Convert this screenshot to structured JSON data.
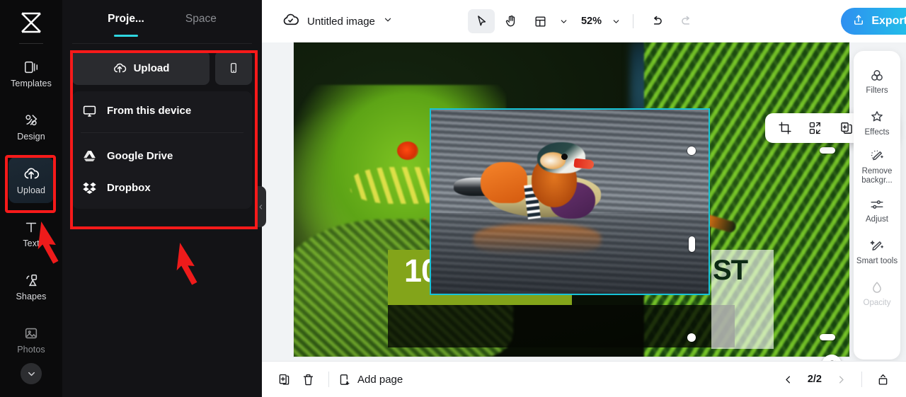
{
  "app": {
    "brand_icon": "capcut-logo-icon",
    "accent": "#2fd6e0",
    "highlight_color": "#f61a1a"
  },
  "left_rail": {
    "items": [
      {
        "label": "Templates",
        "icon": "templates-icon",
        "active": false
      },
      {
        "label": "Design",
        "icon": "design-icon",
        "active": false
      },
      {
        "label": "Upload",
        "icon": "upload-cloud-icon",
        "active": true
      },
      {
        "label": "Text",
        "icon": "text-icon",
        "active": false
      },
      {
        "label": "Shapes",
        "icon": "shapes-icon",
        "active": false
      },
      {
        "label": "Photos",
        "icon": "photos-icon",
        "active": false
      }
    ],
    "more_icon": "chevron-down-icon"
  },
  "panel": {
    "tabs": [
      {
        "label": "Proje...",
        "active": true
      },
      {
        "label": "Space",
        "active": false
      }
    ],
    "upload_button": {
      "label": "Upload",
      "icon": "upload-cloud-icon"
    },
    "phone_button": {
      "icon": "mobile-phone-icon"
    },
    "sources": [
      {
        "label": "From this device",
        "icon": "monitor-icon"
      },
      {
        "label": "Google Drive",
        "icon": "google-drive-icon"
      },
      {
        "label": "Dropbox",
        "icon": "dropbox-icon"
      }
    ],
    "collapse_icon": "chevron-left-icon"
  },
  "topbar": {
    "doc_icon": "cloud-saved-icon",
    "doc_title": "Untitled image",
    "doc_chevron": "chevron-down-icon",
    "tools": [
      {
        "name": "select-tool",
        "icon": "cursor-arrow-icon",
        "selected": true
      },
      {
        "name": "hand-tool",
        "icon": "hand-icon",
        "selected": false
      },
      {
        "name": "layout-tool",
        "icon": "layout-panel-icon",
        "selected": false
      }
    ],
    "zoom_value": "52%",
    "zoom_chevron": "chevron-down-icon",
    "undo_icon": "undo-arrow-icon",
    "redo_icon": "redo-arrow-icon",
    "export_button": {
      "label": "Export",
      "icon": "export-upload-icon"
    }
  },
  "object_toolbar": {
    "buttons": [
      {
        "name": "crop-button",
        "icon": "crop-icon"
      },
      {
        "name": "replace-button",
        "icon": "replace-swap-icon"
      },
      {
        "name": "duplicate-button",
        "icon": "duplicate-icon"
      },
      {
        "name": "more-button",
        "icon": "ellipsis-icon"
      }
    ]
  },
  "canvas": {
    "green_banner_text": "10",
    "ghost_overlay_text": "ST",
    "green_color": "#83a41a",
    "selection_color": "#17c3d6",
    "rotate_icon": "rotate-icon"
  },
  "right_tools": [
    {
      "label": "Filters",
      "icon": "filters-circles-icon",
      "disabled": false
    },
    {
      "label": "Effects",
      "icon": "effects-star-icon",
      "disabled": false
    },
    {
      "label": "Remove backgr...",
      "icon": "remove-background-icon",
      "disabled": false
    },
    {
      "label": "Adjust",
      "icon": "adjust-sliders-icon",
      "disabled": false
    },
    {
      "label": "Smart tools",
      "icon": "smart-tools-wand-icon",
      "disabled": false
    },
    {
      "label": "Opacity",
      "icon": "opacity-droplet-icon",
      "disabled": true
    }
  ],
  "bottombar": {
    "duplicate_page_icon": "duplicate-page-icon",
    "delete_page_icon": "trash-icon",
    "add_page": {
      "label": "Add page",
      "icon": "add-page-icon"
    },
    "prev_icon": "chevron-left-icon",
    "page_indicator": "2/2",
    "next_icon": "chevron-right-icon",
    "expand_icon": "expand-panel-icon"
  }
}
